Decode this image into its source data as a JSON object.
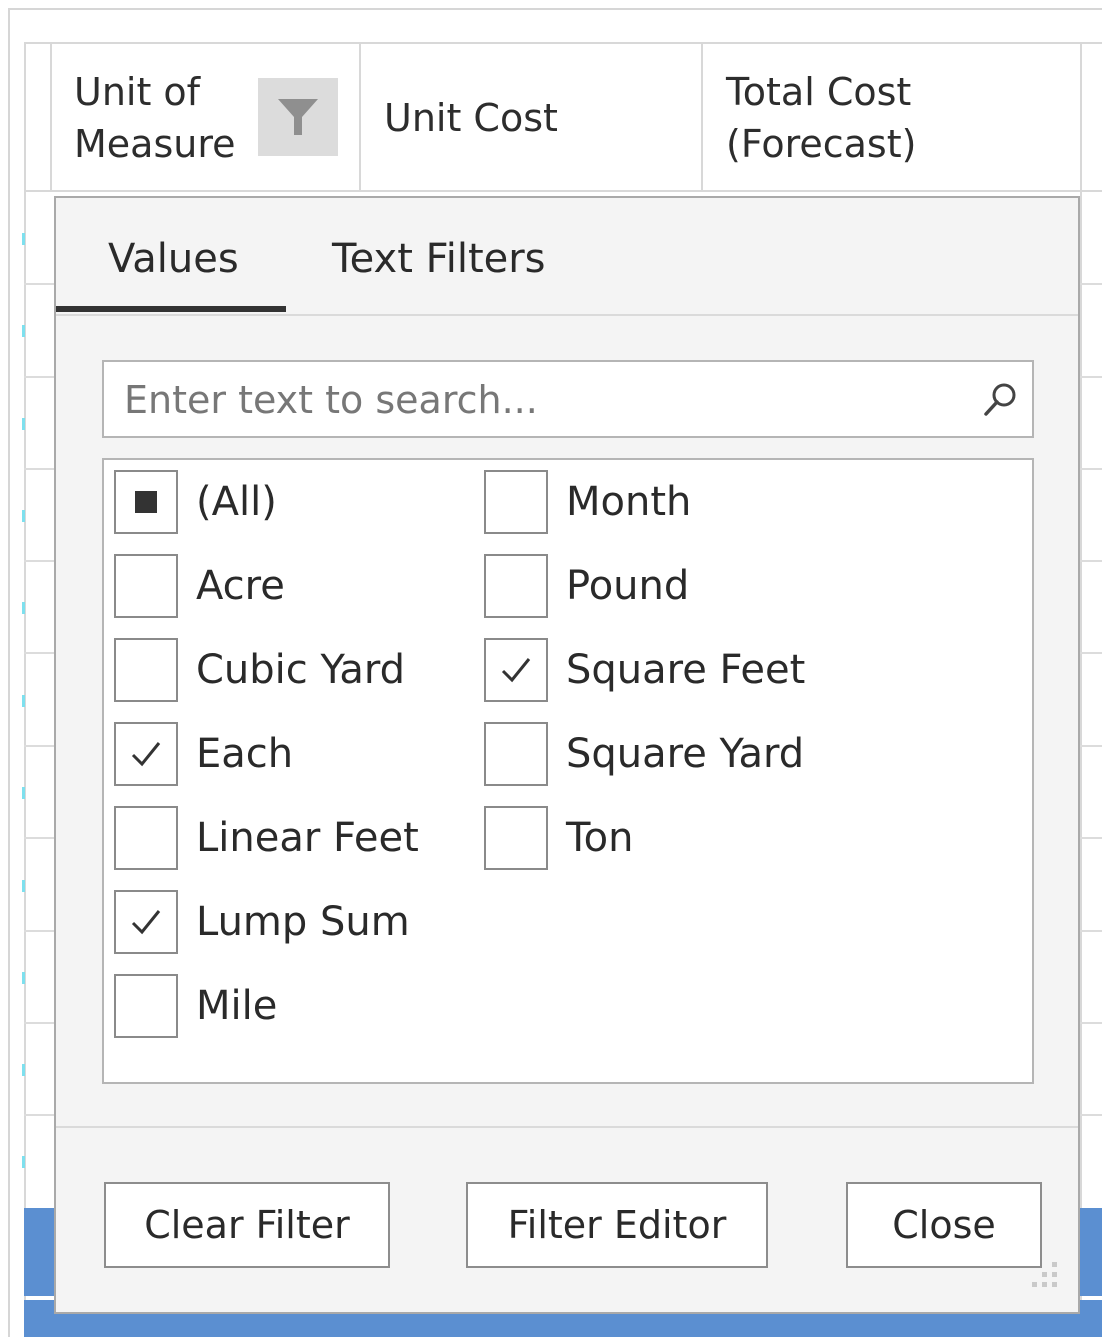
{
  "grid": {
    "columns": [
      {
        "label_line1": "Unit of",
        "label_line2": "Measure"
      },
      {
        "label_line1": "Unit Cost",
        "label_line2": ""
      },
      {
        "label_line1": "Total Cost",
        "label_line2": "(Forecast)"
      }
    ]
  },
  "filter_popup": {
    "tabs": [
      {
        "label": "Values",
        "active": true
      },
      {
        "label": "Text Filters",
        "active": false
      }
    ],
    "search": {
      "placeholder": "Enter text to search..."
    },
    "values": [
      {
        "label": "(All)",
        "state": "indeterminate"
      },
      {
        "label": "Acre",
        "state": "unchecked"
      },
      {
        "label": "Cubic Yard",
        "state": "unchecked"
      },
      {
        "label": "Each",
        "state": "checked"
      },
      {
        "label": "Linear Feet",
        "state": "unchecked"
      },
      {
        "label": "Lump Sum",
        "state": "checked"
      },
      {
        "label": "Mile",
        "state": "unchecked"
      },
      {
        "label": "Month",
        "state": "unchecked"
      },
      {
        "label": "Pound",
        "state": "unchecked"
      },
      {
        "label": "Square Feet",
        "state": "checked"
      },
      {
        "label": "Square Yard",
        "state": "unchecked"
      },
      {
        "label": "Ton",
        "state": "unchecked"
      }
    ],
    "buttons": {
      "clear_filter": "Clear Filter",
      "filter_editor": "Filter Editor",
      "close": "Close"
    }
  },
  "colors": {
    "selected_row": "#5b8fd1",
    "popup_background": "#f4f4f4",
    "accent_marks": "#7ee0ee"
  }
}
